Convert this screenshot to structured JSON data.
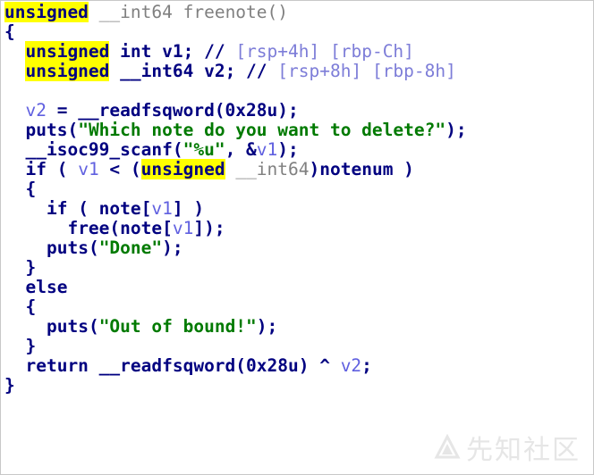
{
  "code": {
    "kw_unsigned": "unsigned",
    "type_int64": "__int64",
    "type_int": "int",
    "func_name": "freenote()",
    "open_brace": "{",
    "close_brace": "}",
    "l2_decl": " v1; //",
    "l2_comment": "[rsp+4h] [rbp-Ch]",
    "l3_decl": " v2; //",
    "l3_comment": "[rsp+8h] [rbp-8h]",
    "var_v1": "v1",
    "var_v2": "v2",
    "l5_mid": " = __readfsqword(0x28u);",
    "puts": "puts",
    "l6_str": "\"Which note do you want to delete?\"",
    "paren_close_semi": ");",
    "l7_fn": "__isoc99_scanf(",
    "l7_str": "\"%u\"",
    "l7_rest": ", &",
    "if_kw": "if",
    "l8_a": " ( ",
    "l8_b": " < (",
    "l8_c": ")notenum )",
    "l10_a": "if ( note[",
    "l10_b": "] )",
    "l11_a": "free(note[",
    "l11_b": "]);",
    "l12_str": "\"Done\"",
    "else_kw": "else",
    "l16_str": "\"Out of bound!\"",
    "l18_a": "return __readfsqword(0x28u) ^ ",
    "semi": ";"
  },
  "watermark": "先知社区"
}
